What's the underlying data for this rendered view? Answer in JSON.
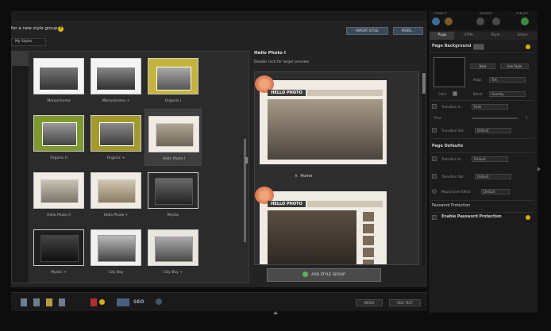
{
  "dialog": {
    "title": "for a new style group",
    "import_label": "IMPORT STYLE",
    "more_label": "MORE...",
    "tab_label": "My Styles"
  },
  "styles": [
    {
      "label": "Monochrome"
    },
    {
      "label": "Monochrome +"
    },
    {
      "label": "Organic I"
    },
    {
      "label": "Organic II"
    },
    {
      "label": "Organic +"
    },
    {
      "label": "Hello Photo I"
    },
    {
      "label": "Hello Photo II"
    },
    {
      "label": "Hello Photo +"
    },
    {
      "label": "Mystic"
    },
    {
      "label": "Mystic +"
    },
    {
      "label": "City Boy"
    },
    {
      "label": "City Boy +"
    }
  ],
  "preview": {
    "title": "Hello Photo I",
    "subtitle": "Double click for larger preview",
    "banner": "HELLO PHOTO",
    "home_label": "Home",
    "close_glyph": "×"
  },
  "add_style_label": "ADD STYLE GROUP",
  "bottom": {
    "seo_label": "SEO",
    "media_label": "MEDIA",
    "add_text_label": "ADD TEXT"
  },
  "panel": {
    "header": {
      "connect": "CONNECT",
      "preview": "PREVIEW",
      "publish": "PUBLISH"
    },
    "tabs": [
      "Page",
      "HTML",
      "Style",
      "Share"
    ],
    "page_background": "Page Background",
    "new_label": "New",
    "use_style_label": "Use Style",
    "align_label": "Align",
    "align_value": "Tile",
    "color_label": "Color",
    "blend_label": "Blend",
    "blend_value": "Overlay",
    "transition_in": "Transition In",
    "transition_in_value": "Fade",
    "time_label": "Time",
    "time_value": "5",
    "transition_out": "Transition Out",
    "transition_out_value": "Default",
    "page_defaults": "Page Defaults",
    "def_transition_in": "Transition In",
    "def_transition_in_value": "Default",
    "def_transition_out": "Transition Out",
    "def_transition_out_value": "Default",
    "mouse_over": "Mouse Over Effect",
    "mouse_over_value": "Default",
    "password_protection": "Password Protection",
    "enable_password": "Enable Password Protection"
  },
  "colors": {
    "accent": "#3b4a58",
    "help": "#e0b800",
    "green": "#58b35a"
  }
}
